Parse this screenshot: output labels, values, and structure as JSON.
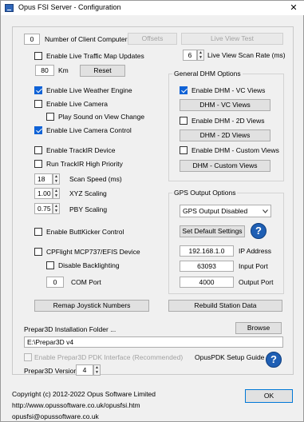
{
  "window": {
    "title": "Opus FSI Server - Configuration",
    "close_glyph": "✕"
  },
  "top": {
    "client_computers_value": "0",
    "client_computers_label": "Number of Client Computers",
    "offsets_label": "Offsets",
    "live_view_test_label": "Live View Test",
    "live_traffic_label": "Enable Live Traffic Map Updates",
    "scan_rate_value": "6",
    "scan_rate_label": "Live View Scan Rate (ms)",
    "km_value": "80",
    "km_label": "Km",
    "reset_label": "Reset"
  },
  "left": {
    "live_weather_label": "Enable Live Weather Engine",
    "live_camera_label": "Enable Live Camera",
    "play_sound_label": "Play Sound on View Change",
    "live_camera_control_label": "Enable Live Camera Control",
    "trackir_label": "Enable TrackIR Device",
    "trackir_priority_label": "Run TrackIR High Priority",
    "scan_speed_value": "18",
    "scan_speed_label": "Scan Speed (ms)",
    "xyz_value": "1.00",
    "xyz_label": "XYZ Scaling",
    "pby_value": "0.75",
    "pby_label": "PBY Scaling",
    "buttkicker_label": "Enable ButtKicker Control",
    "cpflight_label": "CPFlight MCP737/EFIS Device",
    "disable_backlight_label": "Disable Backlighting",
    "com_port_value": "0",
    "com_port_label": "COM Port"
  },
  "dhm": {
    "group_title": "General DHM Options",
    "vc_label": "Enable DHM - VC Views",
    "vc_button": "DHM - VC Views",
    "d2_label": "Enable DHM - 2D Views",
    "d2_button": "DHM - 2D Views",
    "custom_label": "Enable DHM - Custom Views",
    "custom_button": "DHM - Custom Views"
  },
  "gps": {
    "group_title": "GPS Output Options",
    "output_selected": "GPS Output Disabled",
    "defaults_button": "Set Default Settings",
    "ip_value": "192.168.1.0",
    "ip_label": "IP Address",
    "input_port_value": "63093",
    "input_port_label": "Input Port",
    "output_port_value": "4000",
    "output_port_label": "Output Port"
  },
  "bottom_buttons": {
    "remap_label": "Remap Joystick Numbers",
    "rebuild_label": "Rebuild Station Data"
  },
  "prepar3d": {
    "folder_label": "Prepar3D Installation Folder ...",
    "browse_label": "Browse",
    "folder_value": "E:\\Prepar3D v4",
    "pdk_label": "Enable Prepar3D PDK Interface (Recommended)",
    "pdk_guide_label": "OpusPDK Setup Guide",
    "version_label": "Prepar3D Version",
    "version_value": "4"
  },
  "footer": {
    "copyright": "Copyright (c)  2012-2022 Opus Software Limited",
    "website": "http://www.opussoftware.co.uk/opusfsi.htm",
    "email": "opusfsi@opussoftware.co.uk",
    "ok_label": "OK"
  },
  "help_glyph": "?",
  "colors": {
    "accent": "#0f62d6",
    "help": "#1f5fb4"
  }
}
